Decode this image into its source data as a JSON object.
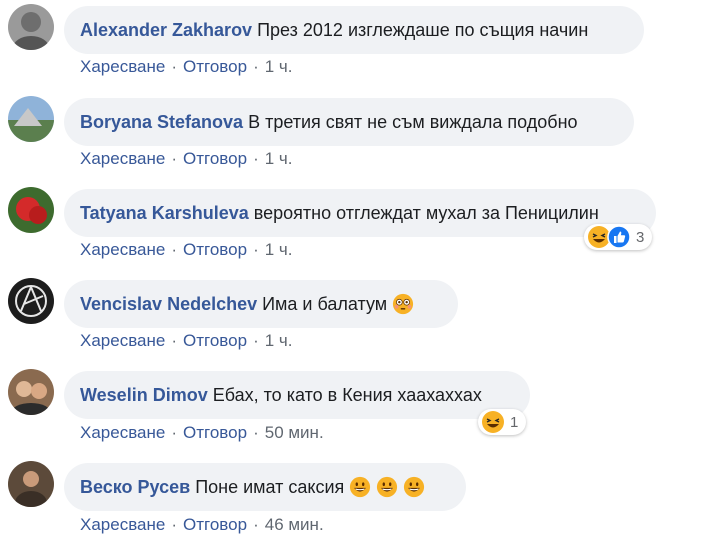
{
  "comments": [
    {
      "author": "Alexander Zakharov",
      "text": "През 2012 изглеждаше по същия начин",
      "like": "Харесване",
      "reply": "Отговор",
      "time": "1 ч."
    },
    {
      "author": "Boryana Stefanova",
      "text": "В третия свят не съм виждала подобно",
      "like": "Харесване",
      "reply": "Отговор",
      "time": "1 ч."
    },
    {
      "author": "Tatyana Karshuleva",
      "text": "вероятно отглеждат мухал за Пеницилин",
      "like": "Харесване",
      "reply": "Отговор",
      "time": "1 ч.",
      "reactions": {
        "icons": [
          "haha",
          "like"
        ],
        "count": "3"
      }
    },
    {
      "author": "Vencislav Nedelchev",
      "text": "Има и балатум",
      "emoji": [
        "flushed-face"
      ],
      "like": "Харесване",
      "reply": "Отговор",
      "time": "1 ч."
    },
    {
      "author": "Weselin Dimov",
      "text": "Ебах, то като в Кения хаахаххах",
      "like": "Харесване",
      "reply": "Отговор",
      "time": "50 мин.",
      "reactions": {
        "icons": [
          "haha"
        ],
        "count": "1"
      }
    },
    {
      "author": "Веско Русев",
      "text": "Поне имат саксия",
      "emoji": [
        "grinning-face",
        "grinning-face",
        "grinning-face"
      ],
      "like": "Харесване",
      "reply": "Отговор",
      "time": "46 мин."
    }
  ],
  "separator": "·",
  "colors": {
    "author": "#365899",
    "bubble": "#f0f2f5",
    "action": "#385898",
    "meta": "#606770",
    "like_blue": "#1877f2",
    "emoji_yellow": "#f7b125"
  }
}
